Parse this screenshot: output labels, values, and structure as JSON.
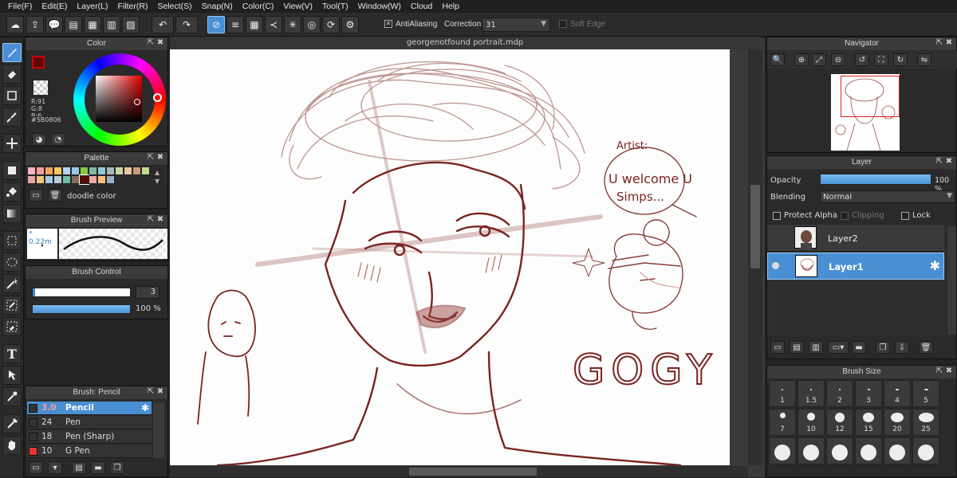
{
  "menu": [
    "File(F)",
    "Edit(E)",
    "Layer(L)",
    "Filter(R)",
    "Select(S)",
    "Snap(N)",
    "Color(C)",
    "View(V)",
    "Tool(T)",
    "Window(W)",
    "Cloud",
    "Help"
  ],
  "toolbar": {
    "antialiasing_label": "AntiAliasing",
    "correction_label": "Correction",
    "correction_value": "31",
    "soft_edge_label": "Soft Edge"
  },
  "document": {
    "tab_title": "georgenotfound portrait.mdp"
  },
  "color_panel": {
    "title": "Color",
    "r": "R:91",
    "g": "G:8",
    "b": "B:6",
    "hex": "#5B0806",
    "fg_color": "#5b0806",
    "bg_color": "#ffffff"
  },
  "palette_panel": {
    "title": "Palette",
    "swatches": [
      "#f6b3c0",
      "#f59c9a",
      "#f2a65a",
      "#f3c85d",
      "#b7d3f0",
      "#9bc4e8",
      "#8dc63f",
      "#7fb7a5",
      "#93c8d8",
      "#a8b8b8",
      "#c7d7a7",
      "#e9c69c",
      "#c79a78",
      "#c4d98a",
      "#e9a3a9",
      "#f1c27d",
      "#a5c8e4",
      "#b8cbd8",
      "#6fbfa7",
      "#8a6b5c",
      "#5b0806",
      "#f1a7a1",
      "#f7c07c",
      "#9cb0c4"
    ],
    "name": "doodle color"
  },
  "brush_preview_panel": {
    "title": "Brush Preview",
    "size": "0.22m"
  },
  "brush_control_panel": {
    "title": "Brush Control",
    "size_value": "3",
    "opacity_value": "100 %"
  },
  "brush_panel": {
    "title": "Brush: Pencil",
    "items": [
      {
        "size": "3.0",
        "name": "Pencil",
        "color": "#333333"
      },
      {
        "size": "24",
        "name": "Pen",
        "color": "#333333"
      },
      {
        "size": "18",
        "name": "Pen (Sharp)",
        "color": "#333333"
      },
      {
        "size": "10",
        "name": "G Pen",
        "color": "#ee3333"
      }
    ]
  },
  "navigator_panel": {
    "title": "Navigator"
  },
  "layer_panel": {
    "title": "Layer",
    "opacity_label": "Opacity",
    "opacity_value": "100 %",
    "blending_label": "Blending",
    "blending_value": "Normal",
    "protect_alpha_label": "Protect Alpha",
    "clipping_label": "Clipping",
    "lock_label": "Lock",
    "layers": [
      {
        "name": "Layer2"
      },
      {
        "name": "Layer1"
      }
    ]
  },
  "brush_size_panel": {
    "title": "Brush Size",
    "sizes": [
      "1",
      "1.5",
      "2",
      "3",
      "4",
      "5",
      "7",
      "10",
      "12",
      "15",
      "20",
      "25"
    ]
  },
  "drawing_text": {
    "artist_note": "Artist:",
    "speech": "U welcome U",
    "speech2": "Simps...",
    "gogy": "GOGY"
  }
}
